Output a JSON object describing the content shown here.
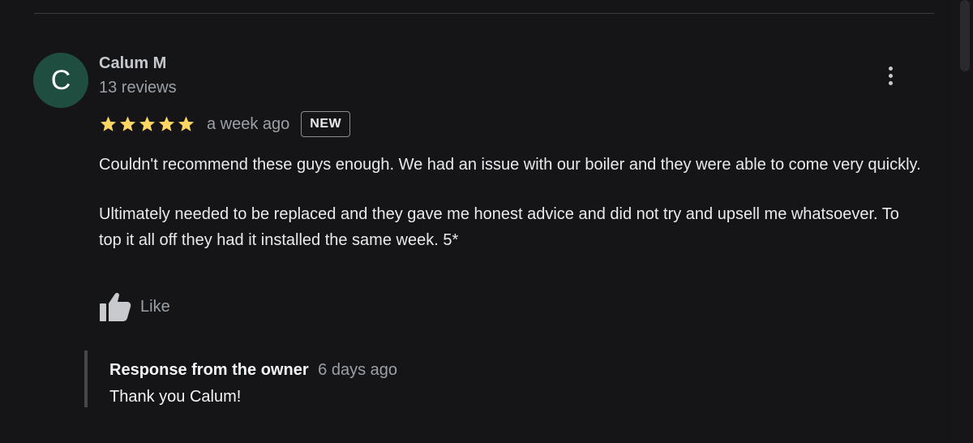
{
  "review": {
    "avatar_letter": "C",
    "avatar_color": "#1f4d3f",
    "reviewer_name": "Calum M",
    "review_count": "13 reviews",
    "rating": 5,
    "rating_max": 5,
    "star_color": "#fdd663",
    "time_ago": "a week ago",
    "badge": "NEW",
    "paragraphs": [
      "Couldn't recommend these guys enough. We had an issue with our boiler and they were able to come very quickly.",
      "Ultimately needed to be replaced and they gave me honest advice and did not try and upsell me whatsoever. To top it all off they had it installed the same week. 5*"
    ],
    "like_label": "Like",
    "like_icon": "thumbs-up-icon",
    "menu_icon": "more-vert-icon"
  },
  "owner_response": {
    "title": "Response from the owner",
    "time_ago": "6 days ago",
    "text": "Thank you Calum!"
  }
}
